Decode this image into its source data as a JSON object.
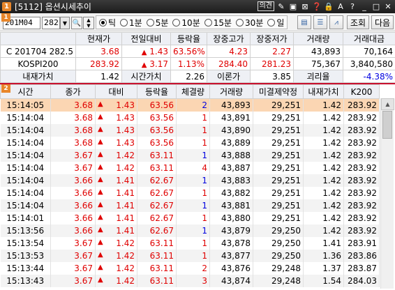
{
  "title_bar": {
    "number": "1",
    "title": "[5112] 옵션시세추이",
    "link_label": "의견",
    "icons": [
      "pin-icon",
      "copy-icon",
      "window-icon",
      "question-icon",
      "lock-icon",
      "font-icon",
      "help-icon",
      "minimize-icon",
      "maximize-icon",
      "close-icon"
    ]
  },
  "section_markers": [
    "1",
    "2"
  ],
  "toolbar": {
    "code_value": "201M04",
    "strike_value": "282",
    "radio_options": [
      {
        "label": "틱",
        "selected": true
      },
      {
        "label": "1분",
        "selected": false
      },
      {
        "label": "5분",
        "selected": false
      },
      {
        "label": "10분",
        "selected": false
      },
      {
        "label": "15분",
        "selected": false
      },
      {
        "label": "30분",
        "selected": false
      },
      {
        "label": "일",
        "selected": false
      }
    ],
    "query_button": "조회",
    "next_button": "다음"
  },
  "summary": {
    "headers": [
      "현재가",
      "전일대비",
      "등락율",
      "장중고가",
      "장중저가",
      "거래량",
      "거래대금"
    ],
    "rows": [
      {
        "name": "C 201704 282.5",
        "price": "3.68",
        "change": "1.43",
        "rate": "63.56%",
        "high": "4.23",
        "low": "2.27",
        "volume": "43,893",
        "amount": "70,164"
      },
      {
        "name": "KOSPI200",
        "price": "283.92",
        "change": "3.17",
        "rate": "1.13%",
        "high": "284.40",
        "low": "281.23",
        "volume": "75,367",
        "amount": "3,840,580"
      }
    ],
    "extra_row": {
      "intrinsic_label": "내재가치",
      "intrinsic_value": "1.42",
      "time_value_label": "시간가치",
      "time_value": "2.26",
      "theory_label": "이론가",
      "theory_value": "3.85",
      "gap_label": "괴리율",
      "gap_value": "-4.38%"
    }
  },
  "ticks": {
    "headers": [
      "시간",
      "종가",
      "대비",
      "등락율",
      "체결량",
      "거래량",
      "미결제약정",
      "내재가치",
      "K200"
    ],
    "rows": [
      [
        "15:14:05",
        "3.68",
        "1.43",
        "63.56",
        "2",
        "43,893",
        "29,251",
        "1.42",
        "283.92"
      ],
      [
        "15:14:04",
        "3.68",
        "1.43",
        "63.56",
        "1",
        "43,891",
        "29,251",
        "1.42",
        "283.92"
      ],
      [
        "15:14:04",
        "3.68",
        "1.43",
        "63.56",
        "1",
        "43,890",
        "29,251",
        "1.42",
        "283.92"
      ],
      [
        "15:14:04",
        "3.68",
        "1.43",
        "63.56",
        "1",
        "43,889",
        "29,251",
        "1.42",
        "283.92"
      ],
      [
        "15:14:04",
        "3.67",
        "1.42",
        "63.11",
        "1",
        "43,888",
        "29,251",
        "1.42",
        "283.92"
      ],
      [
        "15:14:04",
        "3.67",
        "1.42",
        "63.11",
        "4",
        "43,887",
        "29,251",
        "1.42",
        "283.92"
      ],
      [
        "15:14:04",
        "3.66",
        "1.41",
        "62.67",
        "1",
        "43,883",
        "29,251",
        "1.42",
        "283.92"
      ],
      [
        "15:14:04",
        "3.66",
        "1.41",
        "62.67",
        "1",
        "43,882",
        "29,251",
        "1.42",
        "283.92"
      ],
      [
        "15:14:04",
        "3.66",
        "1.41",
        "62.67",
        "1",
        "43,881",
        "29,251",
        "1.42",
        "283.92"
      ],
      [
        "15:14:01",
        "3.66",
        "1.41",
        "62.67",
        "1",
        "43,880",
        "29,251",
        "1.42",
        "283.92"
      ],
      [
        "15:13:56",
        "3.66",
        "1.41",
        "62.67",
        "1",
        "43,879",
        "29,250",
        "1.42",
        "283.92"
      ],
      [
        "15:13:54",
        "3.67",
        "1.42",
        "63.11",
        "1",
        "43,878",
        "29,250",
        "1.41",
        "283.91"
      ],
      [
        "15:13:53",
        "3.67",
        "1.42",
        "63.11",
        "1",
        "43,877",
        "29,250",
        "1.36",
        "283.86"
      ],
      [
        "15:13:44",
        "3.67",
        "1.42",
        "63.11",
        "2",
        "43,876",
        "29,248",
        "1.37",
        "283.87"
      ],
      [
        "15:13:43",
        "3.67",
        "1.42",
        "63.11",
        "3",
        "43,874",
        "29,248",
        "1.54",
        "284.03"
      ]
    ],
    "volume_colors": [
      "blue",
      "red",
      "red",
      "red",
      "blue",
      "red",
      "blue",
      "red",
      "blue",
      "red",
      "blue",
      "red",
      "red",
      "red",
      "red"
    ]
  },
  "colors": {
    "rise": "#e00000",
    "fall": "#0000e0",
    "header_bg": "#eef0f5",
    "selected_row": "#fbd6b3",
    "accent": "#e8862a",
    "separator": "#c8102e"
  }
}
